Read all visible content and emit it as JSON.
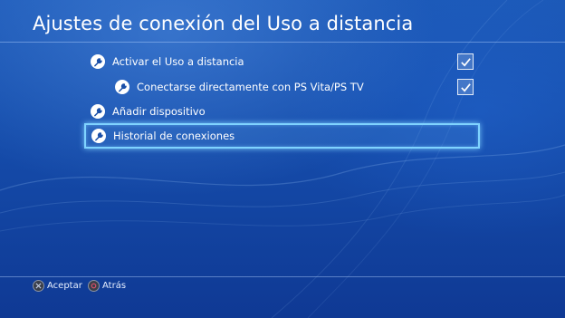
{
  "header": {
    "title": "Ajustes de conexión del Uso a distancia"
  },
  "menu": {
    "items": [
      {
        "label": "Activar el Uso a distancia",
        "icon": "wrench-icon",
        "checked": true
      },
      {
        "label": "Conectarse directamente con PS Vita/PS TV",
        "icon": "wrench-icon",
        "checked": true
      },
      {
        "label": "Añadir dispositivo",
        "icon": "wrench-icon"
      },
      {
        "label": "Historial de conexiones",
        "icon": "wrench-icon",
        "selected": true
      }
    ]
  },
  "footer": {
    "accept_label": "Aceptar",
    "accept_icon": "cross-button-icon",
    "back_label": "Atrás",
    "back_icon": "circle-button-icon"
  },
  "colors": {
    "background": "#164fae",
    "selection_border": "#7fd3ff",
    "text": "#ffffff"
  }
}
